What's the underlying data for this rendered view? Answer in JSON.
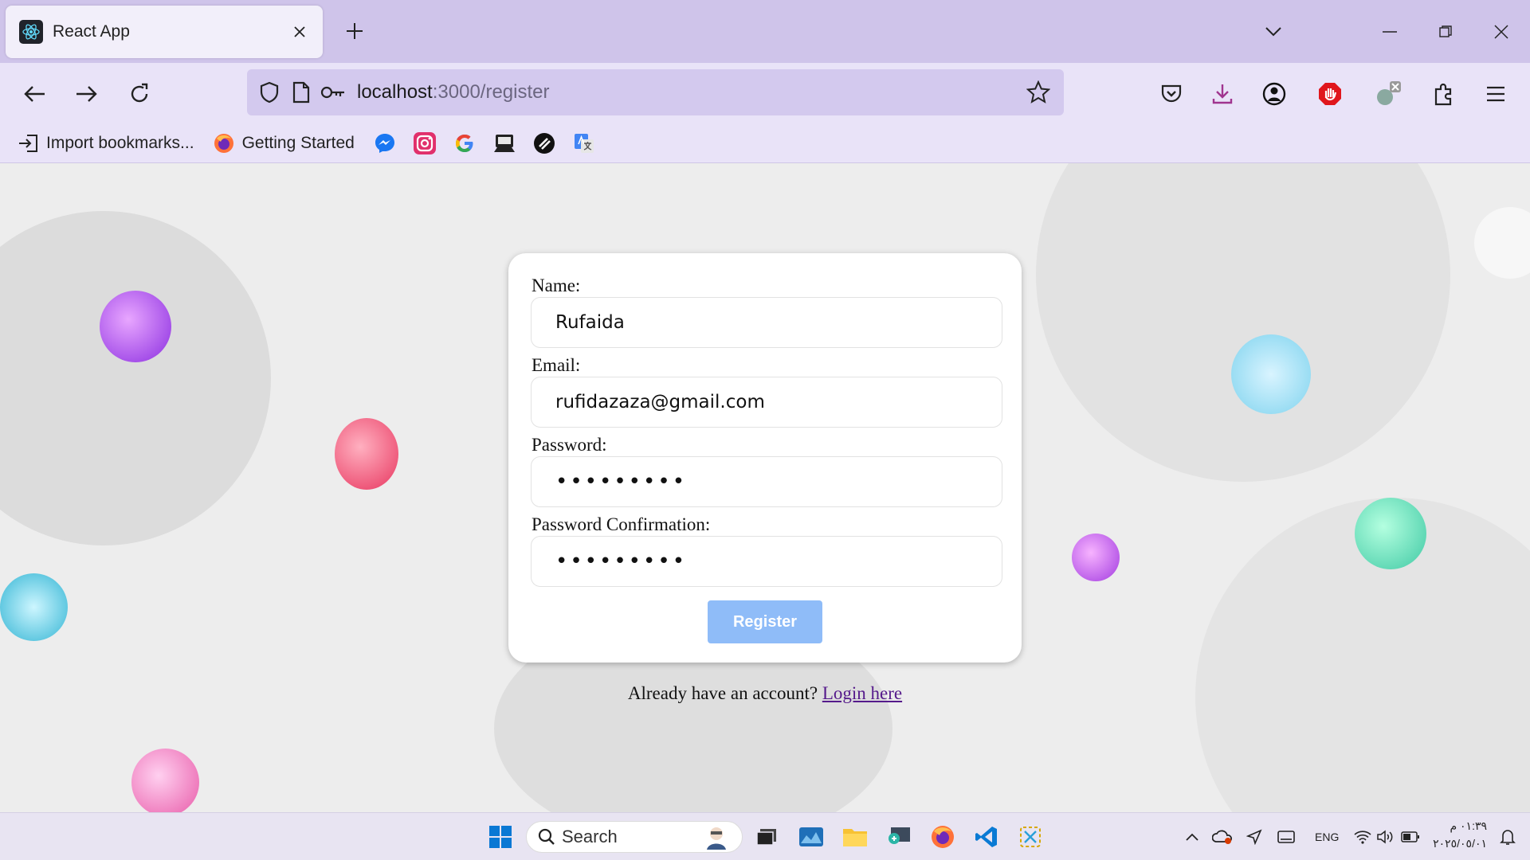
{
  "browser": {
    "tab_title": "React App",
    "url_host": "localhost",
    "url_path": ":3000/register"
  },
  "bookmarks": {
    "import_label": "Import bookmarks...",
    "getting_started_label": "Getting Started"
  },
  "form": {
    "name_label": "Name:",
    "name_value": "Rufaida",
    "email_label": "Email:",
    "email_value": "rufidazaza@gmail.com",
    "password_label": "Password:",
    "password_value": "•••••••••",
    "confirm_label": "Password Confirmation:",
    "confirm_value": "•••••••••",
    "register_label": "Register",
    "register_color": "#8fbcf8",
    "login_prompt": "Already have an account? ",
    "login_link": "Login here"
  },
  "taskbar": {
    "search_placeholder": "Search",
    "language": "ENG",
    "time": "٠١:٣٩ م",
    "date": "٢٠٢٥/٠٥/٠١"
  }
}
